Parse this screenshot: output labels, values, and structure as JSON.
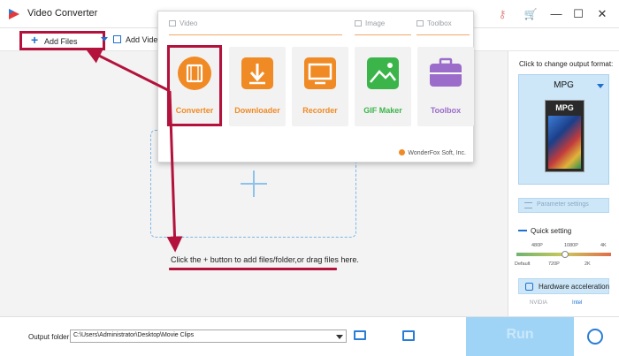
{
  "window": {
    "title": "Video Converter",
    "icons": [
      "app-logo-icon",
      "key-icon",
      "cart-icon",
      "menu-icon"
    ],
    "controls": {
      "minimize": "—",
      "maximize": "☐",
      "close": "✕"
    }
  },
  "toolbar": {
    "add_files_label": "Add Files",
    "add_video_label": "Add Vide"
  },
  "popup": {
    "sections": {
      "video": "Video",
      "image": "Image",
      "toolbox": "Toolbox"
    },
    "tiles": [
      {
        "id": "converter",
        "label": "Converter",
        "color": "#f08a24"
      },
      {
        "id": "downloader",
        "label": "Downloader",
        "color": "#f08a24"
      },
      {
        "id": "recorder",
        "label": "Recorder",
        "color": "#f08a24"
      },
      {
        "id": "gif-maker",
        "label": "GIF Maker",
        "color": "#3bb54a"
      },
      {
        "id": "toolbox",
        "label": "Toolbox",
        "color": "#9b6cc9"
      }
    ],
    "brand": "WonderFox Soft, Inc."
  },
  "drop_zone": {
    "hint": "Click the + button to add files/folder,or drag files here."
  },
  "output_panel": {
    "title": "Click to change output format:",
    "format": "MPG",
    "format_badge": "MPG",
    "parameter_settings": "Parameter settings",
    "quick_setting": "Quick setting",
    "scale_top": [
      "480P",
      "1080P",
      "4K"
    ],
    "scale_bottom": [
      "Default",
      "720P",
      "2K"
    ],
    "hardware_acceleration": "Hardware acceleration",
    "vendors": [
      "NVIDIA",
      "Intel"
    ]
  },
  "bottom": {
    "output_folder_label": "Output folder:",
    "output_folder_value": "C:\\Users\\Administrator\\Desktop\\Movie Clips",
    "run_label": "Run"
  },
  "colors": {
    "highlight": "#b3123c",
    "accent_blue": "#1e6fd0",
    "run_bg": "#9fd4f7"
  }
}
